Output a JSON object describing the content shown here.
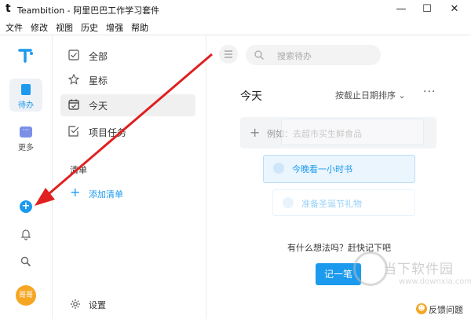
{
  "window": {
    "app_logo": "t",
    "title": "Teambition - 阿里巴巴工作学习套件",
    "min": "—",
    "max": "☐",
    "close": "✕"
  },
  "menubar": [
    "文件",
    "修改",
    "视图",
    "历史",
    "增强",
    "帮助"
  ],
  "rail": {
    "todo_label": "待办",
    "more_label": "更多",
    "avatar_text": "哥哥",
    "add": "+"
  },
  "sidebar": {
    "items": [
      {
        "label": "全部"
      },
      {
        "label": "星标"
      },
      {
        "label": "今天"
      },
      {
        "label": "项目任务"
      }
    ],
    "section_title": "清单",
    "add_list": "添加清单",
    "settings": "设置"
  },
  "main": {
    "search_placeholder": "搜索待办",
    "title": "今天",
    "sort": "按截止日期排序 ⌄",
    "more": "···",
    "add_task_placeholder": "例如：去超市买生鲜食品",
    "tasks": [
      {
        "label": "今晚看一小时书"
      },
      {
        "label": "准备圣诞节礼物"
      }
    ],
    "prompt": "有什么想法吗？赶快记下吧",
    "write_button": "记一笔"
  },
  "watermark": {
    "text": "当下软件园",
    "url": "www.downxia.com"
  },
  "feedback": {
    "icon": "☻",
    "label": "反馈问题"
  },
  "colors": {
    "accent": "#1b9aee",
    "arrow": "#e02020",
    "avatar": "#f5a623"
  }
}
